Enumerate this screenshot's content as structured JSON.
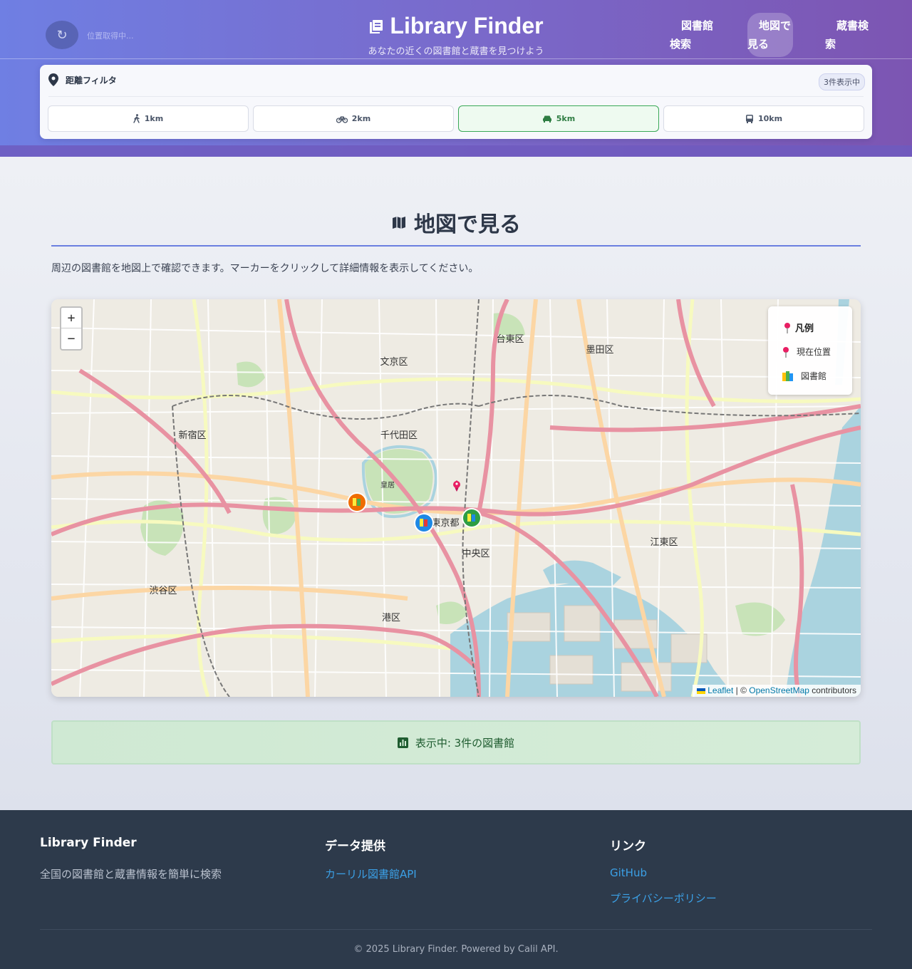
{
  "header": {
    "location_status": "位置取得中...",
    "title": "Library Finder",
    "subtitle": "あなたの近くの図書館と蔵書を見つけよう",
    "nav": [
      {
        "line1": "図書館",
        "line2": "検索"
      },
      {
        "line1": "地図で",
        "line2": "見る",
        "active": true
      },
      {
        "line1": "蔵書検",
        "line2": "索"
      }
    ]
  },
  "filter": {
    "title": "距離フィルタ",
    "count": "3件表示中",
    "options": [
      {
        "label": "1km",
        "icon": "walking-icon"
      },
      {
        "label": "2km",
        "icon": "bicycle-icon"
      },
      {
        "label": "5km",
        "icon": "car-icon",
        "active": true
      },
      {
        "label": "10km",
        "icon": "bus-icon"
      }
    ]
  },
  "section": {
    "title": "地図で見る",
    "description": "周辺の図書館を地図上で確認できます。マーカーをクリックして詳細情報を表示してください。"
  },
  "map": {
    "zoom_in": "+",
    "zoom_out": "−",
    "legend": {
      "title": "凡例",
      "current": "現在位置",
      "library": "図書館"
    },
    "attribution": {
      "leaflet": "Leaflet",
      "sep": " | © ",
      "osm": "OpenStreetMap",
      "suffix": " contributors"
    },
    "labels": [
      "文京区",
      "台東区",
      "墨田区",
      "千代田区",
      "新宿区",
      "東京都",
      "中央区",
      "江東区",
      "渋谷区",
      "港区",
      "皇居"
    ],
    "markers": [
      {
        "color": "#ef6c00"
      },
      {
        "color": "#1e88e5"
      },
      {
        "color": "#2e9e44"
      }
    ]
  },
  "status": "表示中: 3件の図書館",
  "footer": {
    "col1": {
      "title": "Library Finder",
      "text": "全国の図書館と蔵書情報を簡単に検索"
    },
    "col2": {
      "title": "データ提供",
      "link": "カーリル図書館API"
    },
    "col3": {
      "title": "リンク",
      "links": [
        "GitHub",
        "プライバシーポリシー"
      ]
    },
    "copyright": "© 2025 Library Finder. Powered by Calil API."
  }
}
